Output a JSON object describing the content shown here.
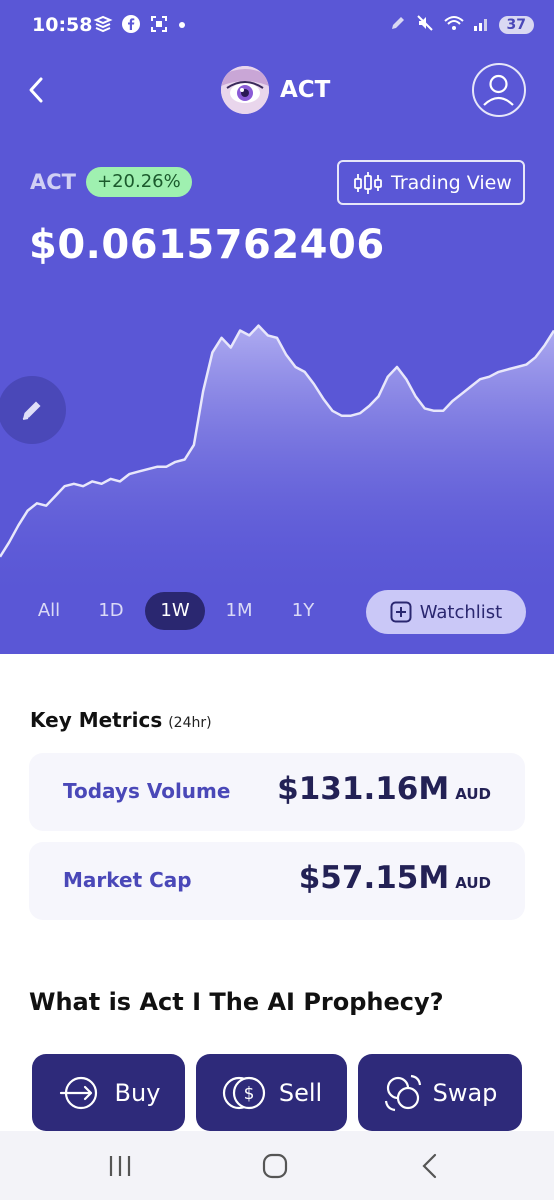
{
  "status_bar": {
    "time": "10:58",
    "battery": "37",
    "left_icons": [
      "app-icon",
      "facebook-icon",
      "screenshot-icon",
      "dot-icon"
    ],
    "right_icons": [
      "pen-icon",
      "mute-icon",
      "wifi-icon",
      "signal-icon"
    ]
  },
  "header": {
    "title": "ACT",
    "back_icon": "chevron-left-icon",
    "profile_icon": "user-circle-icon"
  },
  "coin": {
    "symbol": "ACT",
    "change": "+20.26%",
    "price": "$0.0615762406",
    "trading_view_label": "Trading View"
  },
  "colors": {
    "hero_bg": "#5a57d6",
    "positive_badge_bg": "#9ff0b0",
    "active_tab_bg": "#2a2770",
    "action_button_bg": "#2e2a7a",
    "accent_text": "#4a48b8"
  },
  "chart_data": {
    "type": "area",
    "x": [
      0,
      1,
      2,
      3,
      4,
      5,
      6,
      7,
      8,
      9,
      10,
      11,
      12,
      13,
      14,
      15,
      16,
      17,
      18,
      19,
      20,
      21,
      22,
      23,
      24,
      25,
      26,
      27,
      28,
      29,
      30,
      31,
      32,
      33,
      34,
      35,
      36,
      37,
      38,
      39,
      40,
      41,
      42,
      43,
      44,
      45,
      46,
      47,
      48,
      49,
      50,
      51,
      52,
      53,
      54,
      55,
      56,
      57,
      58,
      59,
      60
    ],
    "values": [
      0.0512,
      0.0518,
      0.0525,
      0.0531,
      0.0534,
      0.0533,
      0.0537,
      0.0541,
      0.0542,
      0.0541,
      0.0543,
      0.0542,
      0.0544,
      0.0543,
      0.0546,
      0.0547,
      0.0548,
      0.0549,
      0.0549,
      0.0551,
      0.0552,
      0.0558,
      0.058,
      0.0596,
      0.0602,
      0.0598,
      0.0605,
      0.0603,
      0.0607,
      0.0603,
      0.0602,
      0.0595,
      0.059,
      0.0588,
      0.0583,
      0.0577,
      0.0572,
      0.057,
      0.057,
      0.0571,
      0.0574,
      0.0578,
      0.0586,
      0.059,
      0.0585,
      0.0578,
      0.0573,
      0.0572,
      0.0572,
      0.0576,
      0.0579,
      0.0582,
      0.0585,
      0.0586,
      0.0588,
      0.0589,
      0.059,
      0.0591,
      0.0594,
      0.0599,
      0.0605
    ],
    "ylim": [
      0.05,
      0.062
    ]
  },
  "range_tabs": [
    {
      "label": "All",
      "active": false
    },
    {
      "label": "1D",
      "active": false
    },
    {
      "label": "1W",
      "active": true
    },
    {
      "label": "1M",
      "active": false
    },
    {
      "label": "1Y",
      "active": false
    }
  ],
  "watchlist_label": "Watchlist",
  "metrics": {
    "title": "Key Metrics",
    "subtitle": "(24hr)",
    "items": [
      {
        "label": "Todays Volume",
        "value": "$131.16M",
        "unit": "AUD"
      },
      {
        "label": "Market Cap",
        "value": "$57.15M",
        "unit": "AUD"
      }
    ]
  },
  "about_title": "What is Act I The AI Prophecy?",
  "actions": [
    {
      "label": "Buy",
      "icon": "arrow-right-circle-icon"
    },
    {
      "label": "Sell",
      "icon": "coins-dollar-icon"
    },
    {
      "label": "Swap",
      "icon": "swap-circles-icon"
    }
  ],
  "nav_bar": [
    "recent-apps-icon",
    "home-icon",
    "back-icon"
  ]
}
